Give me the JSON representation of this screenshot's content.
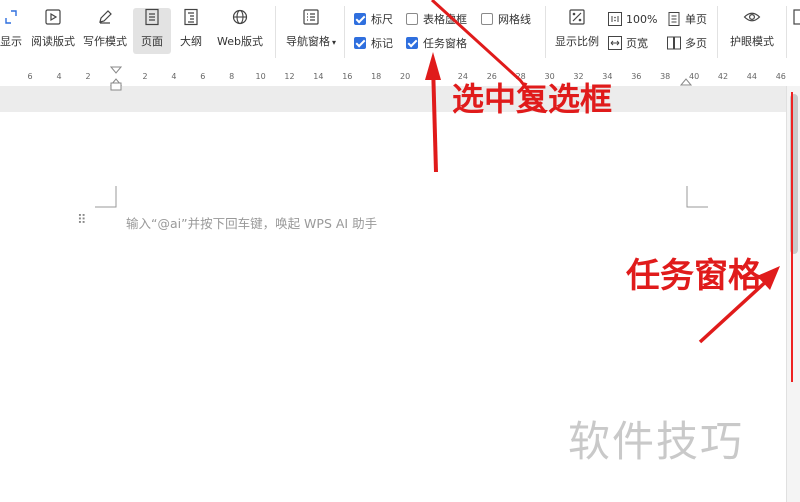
{
  "ribbon": {
    "buttons": [
      {
        "name": "show-button",
        "label": "显示",
        "icon": "expand-icon"
      },
      {
        "name": "reading-mode-button",
        "label": "阅读版式",
        "icon": "play-icon"
      },
      {
        "name": "writing-mode-button",
        "label": "写作模式",
        "icon": "pen-icon"
      },
      {
        "name": "page-view-button",
        "label": "页面",
        "icon": "page-icon"
      },
      {
        "name": "outline-button",
        "label": "大纲",
        "icon": "outline-icon"
      },
      {
        "name": "web-layout-button",
        "label": "Web版式",
        "icon": "globe-icon"
      },
      {
        "name": "nav-pane-button",
        "label": "导航窗格",
        "icon": "list-icon"
      },
      {
        "name": "zoom-ratio-button",
        "label": "显示比例",
        "icon": "percent-icon"
      },
      {
        "name": "eye-protect-button",
        "label": "护眼模式",
        "icon": "eye-icon"
      }
    ],
    "checkboxes": {
      "ruler": {
        "label": "标尺",
        "checked": true
      },
      "mark": {
        "label": "标记",
        "checked": true
      },
      "table_border": {
        "label": "表格虚框",
        "checked": false
      },
      "task_pane": {
        "label": "任务窗格",
        "checked": true
      },
      "gridlines": {
        "label": "网格线",
        "checked": false
      }
    },
    "zoom": {
      "hundred": "100%",
      "page_width": "页宽",
      "single_page": "单页",
      "multi_page": "多页"
    }
  },
  "ruler": {
    "left_ticks": [
      "6",
      "4",
      "2"
    ],
    "right_ticks": [
      "2",
      "4",
      "6",
      "8",
      "10",
      "12",
      "14",
      "16",
      "18",
      "20",
      "22",
      "24",
      "26",
      "28",
      "30",
      "32",
      "34",
      "36",
      "38",
      "40",
      "42",
      "44",
      "46"
    ]
  },
  "document": {
    "placeholder": "输入“@ai”并按下回车键，唤起 WPS AI 助手"
  },
  "annotations": {
    "select_checkbox": "选中复选框",
    "task_pane": "任务窗格",
    "accent": "#e01b1b"
  },
  "watermark": "软件技巧"
}
